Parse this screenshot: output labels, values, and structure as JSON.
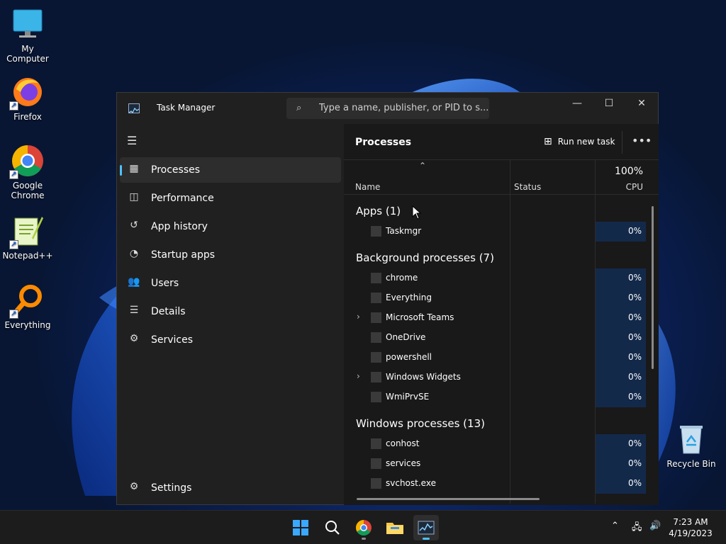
{
  "desktop": {
    "icons": [
      {
        "label": "My Computer",
        "icon": "monitor-icon"
      },
      {
        "label": "Firefox",
        "icon": "firefox-icon"
      },
      {
        "label": "Google Chrome",
        "icon": "chrome-icon"
      },
      {
        "label": "Notepad++",
        "icon": "notepad-icon"
      },
      {
        "label": "Everything",
        "icon": "magnifier-icon"
      },
      {
        "label": "Recycle Bin",
        "icon": "recycle-bin-icon"
      }
    ]
  },
  "window": {
    "title": "Task Manager",
    "search_placeholder": "Type a name, publisher, or PID to s...",
    "controls": {
      "minimize": "—",
      "maximize": "☐",
      "close": "✕"
    }
  },
  "sidebar": {
    "items": [
      {
        "label": "Processes",
        "icon": "processes-icon",
        "active": true
      },
      {
        "label": "Performance",
        "icon": "performance-icon"
      },
      {
        "label": "App history",
        "icon": "history-icon"
      },
      {
        "label": "Startup apps",
        "icon": "startup-icon"
      },
      {
        "label": "Users",
        "icon": "users-icon"
      },
      {
        "label": "Details",
        "icon": "details-icon"
      },
      {
        "label": "Services",
        "icon": "services-icon"
      }
    ],
    "settings_label": "Settings"
  },
  "content": {
    "title": "Processes",
    "run_new_task": "Run new task",
    "columns": {
      "name": "Name",
      "status": "Status",
      "cpu": "CPU",
      "cpu_total": "100%"
    },
    "groups": [
      {
        "label": "Apps (1)",
        "processes": [
          {
            "name": "Taskmgr",
            "cpu": "0%"
          }
        ]
      },
      {
        "label": "Background processes (7)",
        "processes": [
          {
            "name": "chrome",
            "cpu": "0%"
          },
          {
            "name": "Everything",
            "cpu": "0%"
          },
          {
            "name": "Microsoft Teams",
            "cpu": "0%",
            "expandable": true
          },
          {
            "name": "OneDrive",
            "cpu": "0%"
          },
          {
            "name": "powershell",
            "cpu": "0%"
          },
          {
            "name": "Windows Widgets",
            "cpu": "0%",
            "expandable": true
          },
          {
            "name": "WmiPrvSE",
            "cpu": "0%"
          }
        ]
      },
      {
        "label": "Windows processes (13)",
        "processes": [
          {
            "name": "conhost",
            "cpu": "0%"
          },
          {
            "name": "services",
            "cpu": "0%"
          },
          {
            "name": "svchost.exe",
            "cpu": "0%"
          }
        ]
      }
    ]
  },
  "taskbar": {
    "time": "7:23 AM",
    "date": "4/19/2023"
  }
}
